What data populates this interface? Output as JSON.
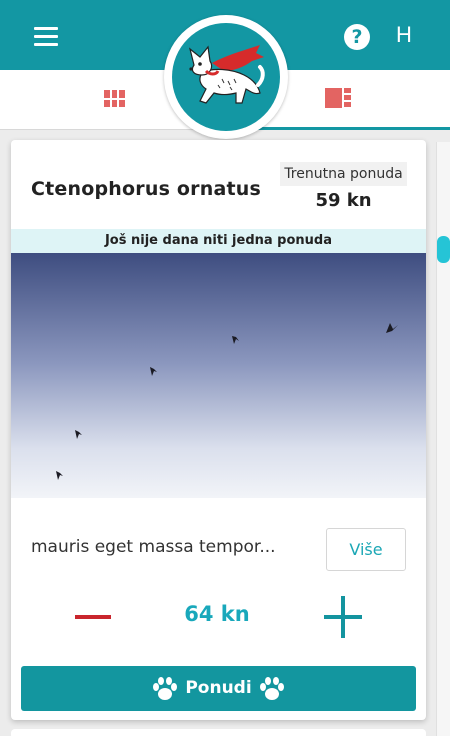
{
  "header": {
    "menu_icon": "hamburger-menu-icon",
    "logo": "superhero-dog-logo",
    "help_icon": "question-circle-icon",
    "help_symbol": "?",
    "user_initial": "H",
    "colors": {
      "primary": "#1397a3",
      "accent": "#e36462"
    }
  },
  "tabs": [
    {
      "icon": "grid-view-icon",
      "active": false
    },
    {
      "icon": "detail-view-icon",
      "active": true
    }
  ],
  "auction": {
    "title": "Ctenophorus ornatus",
    "current_bid_label": "Trenutna ponuda",
    "current_bid_value": "59 kn",
    "notice": "Još nije dana niti jedna ponuda",
    "image_alt": "birds-in-sky",
    "description": "mauris eget massa tempor...",
    "more_label": "Više",
    "bid_amount": "64 kn",
    "bid_button_label": "Ponudi",
    "colors": {
      "minus": "#c9252d",
      "plus": "#13949f",
      "amount": "#19a8bb"
    }
  }
}
